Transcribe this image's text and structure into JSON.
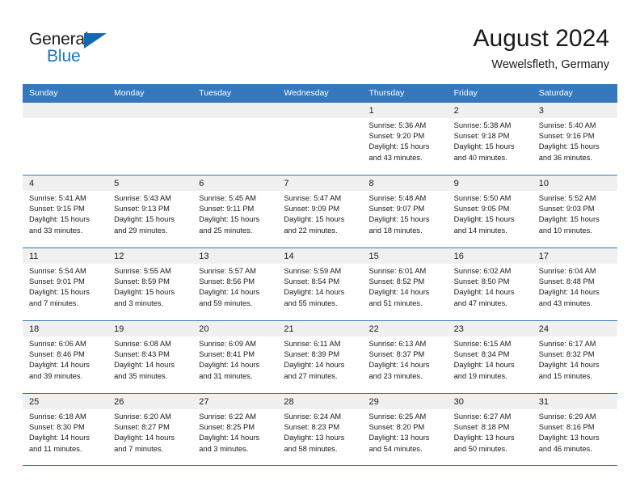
{
  "brand": {
    "name_part1": "General",
    "name_part2": "Blue",
    "accent_color": "#1476c6"
  },
  "header": {
    "title": "August 2024",
    "subtitle": "Wewelsfleth, Germany"
  },
  "calendar": {
    "header_bg": "#3578bd",
    "weekdays": [
      "Sunday",
      "Monday",
      "Tuesday",
      "Wednesday",
      "Thursday",
      "Friday",
      "Saturday"
    ],
    "weeks": [
      [
        {
          "day": "",
          "lines": []
        },
        {
          "day": "",
          "lines": []
        },
        {
          "day": "",
          "lines": []
        },
        {
          "day": "",
          "lines": []
        },
        {
          "day": "1",
          "lines": [
            "Sunrise: 5:36 AM",
            "Sunset: 9:20 PM",
            "Daylight: 15 hours",
            "and 43 minutes."
          ]
        },
        {
          "day": "2",
          "lines": [
            "Sunrise: 5:38 AM",
            "Sunset: 9:18 PM",
            "Daylight: 15 hours",
            "and 40 minutes."
          ]
        },
        {
          "day": "3",
          "lines": [
            "Sunrise: 5:40 AM",
            "Sunset: 9:16 PM",
            "Daylight: 15 hours",
            "and 36 minutes."
          ]
        }
      ],
      [
        {
          "day": "4",
          "lines": [
            "Sunrise: 5:41 AM",
            "Sunset: 9:15 PM",
            "Daylight: 15 hours",
            "and 33 minutes."
          ]
        },
        {
          "day": "5",
          "lines": [
            "Sunrise: 5:43 AM",
            "Sunset: 9:13 PM",
            "Daylight: 15 hours",
            "and 29 minutes."
          ]
        },
        {
          "day": "6",
          "lines": [
            "Sunrise: 5:45 AM",
            "Sunset: 9:11 PM",
            "Daylight: 15 hours",
            "and 25 minutes."
          ]
        },
        {
          "day": "7",
          "lines": [
            "Sunrise: 5:47 AM",
            "Sunset: 9:09 PM",
            "Daylight: 15 hours",
            "and 22 minutes."
          ]
        },
        {
          "day": "8",
          "lines": [
            "Sunrise: 5:48 AM",
            "Sunset: 9:07 PM",
            "Daylight: 15 hours",
            "and 18 minutes."
          ]
        },
        {
          "day": "9",
          "lines": [
            "Sunrise: 5:50 AM",
            "Sunset: 9:05 PM",
            "Daylight: 15 hours",
            "and 14 minutes."
          ]
        },
        {
          "day": "10",
          "lines": [
            "Sunrise: 5:52 AM",
            "Sunset: 9:03 PM",
            "Daylight: 15 hours",
            "and 10 minutes."
          ]
        }
      ],
      [
        {
          "day": "11",
          "lines": [
            "Sunrise: 5:54 AM",
            "Sunset: 9:01 PM",
            "Daylight: 15 hours",
            "and 7 minutes."
          ]
        },
        {
          "day": "12",
          "lines": [
            "Sunrise: 5:55 AM",
            "Sunset: 8:59 PM",
            "Daylight: 15 hours",
            "and 3 minutes."
          ]
        },
        {
          "day": "13",
          "lines": [
            "Sunrise: 5:57 AM",
            "Sunset: 8:56 PM",
            "Daylight: 14 hours",
            "and 59 minutes."
          ]
        },
        {
          "day": "14",
          "lines": [
            "Sunrise: 5:59 AM",
            "Sunset: 8:54 PM",
            "Daylight: 14 hours",
            "and 55 minutes."
          ]
        },
        {
          "day": "15",
          "lines": [
            "Sunrise: 6:01 AM",
            "Sunset: 8:52 PM",
            "Daylight: 14 hours",
            "and 51 minutes."
          ]
        },
        {
          "day": "16",
          "lines": [
            "Sunrise: 6:02 AM",
            "Sunset: 8:50 PM",
            "Daylight: 14 hours",
            "and 47 minutes."
          ]
        },
        {
          "day": "17",
          "lines": [
            "Sunrise: 6:04 AM",
            "Sunset: 8:48 PM",
            "Daylight: 14 hours",
            "and 43 minutes."
          ]
        }
      ],
      [
        {
          "day": "18",
          "lines": [
            "Sunrise: 6:06 AM",
            "Sunset: 8:46 PM",
            "Daylight: 14 hours",
            "and 39 minutes."
          ]
        },
        {
          "day": "19",
          "lines": [
            "Sunrise: 6:08 AM",
            "Sunset: 8:43 PM",
            "Daylight: 14 hours",
            "and 35 minutes."
          ]
        },
        {
          "day": "20",
          "lines": [
            "Sunrise: 6:09 AM",
            "Sunset: 8:41 PM",
            "Daylight: 14 hours",
            "and 31 minutes."
          ]
        },
        {
          "day": "21",
          "lines": [
            "Sunrise: 6:11 AM",
            "Sunset: 8:39 PM",
            "Daylight: 14 hours",
            "and 27 minutes."
          ]
        },
        {
          "day": "22",
          "lines": [
            "Sunrise: 6:13 AM",
            "Sunset: 8:37 PM",
            "Daylight: 14 hours",
            "and 23 minutes."
          ]
        },
        {
          "day": "23",
          "lines": [
            "Sunrise: 6:15 AM",
            "Sunset: 8:34 PM",
            "Daylight: 14 hours",
            "and 19 minutes."
          ]
        },
        {
          "day": "24",
          "lines": [
            "Sunrise: 6:17 AM",
            "Sunset: 8:32 PM",
            "Daylight: 14 hours",
            "and 15 minutes."
          ]
        }
      ],
      [
        {
          "day": "25",
          "lines": [
            "Sunrise: 6:18 AM",
            "Sunset: 8:30 PM",
            "Daylight: 14 hours",
            "and 11 minutes."
          ]
        },
        {
          "day": "26",
          "lines": [
            "Sunrise: 6:20 AM",
            "Sunset: 8:27 PM",
            "Daylight: 14 hours",
            "and 7 minutes."
          ]
        },
        {
          "day": "27",
          "lines": [
            "Sunrise: 6:22 AM",
            "Sunset: 8:25 PM",
            "Daylight: 14 hours",
            "and 3 minutes."
          ]
        },
        {
          "day": "28",
          "lines": [
            "Sunrise: 6:24 AM",
            "Sunset: 8:23 PM",
            "Daylight: 13 hours",
            "and 58 minutes."
          ]
        },
        {
          "day": "29",
          "lines": [
            "Sunrise: 6:25 AM",
            "Sunset: 8:20 PM",
            "Daylight: 13 hours",
            "and 54 minutes."
          ]
        },
        {
          "day": "30",
          "lines": [
            "Sunrise: 6:27 AM",
            "Sunset: 8:18 PM",
            "Daylight: 13 hours",
            "and 50 minutes."
          ]
        },
        {
          "day": "31",
          "lines": [
            "Sunrise: 6:29 AM",
            "Sunset: 8:16 PM",
            "Daylight: 13 hours",
            "and 46 minutes."
          ]
        }
      ]
    ]
  }
}
